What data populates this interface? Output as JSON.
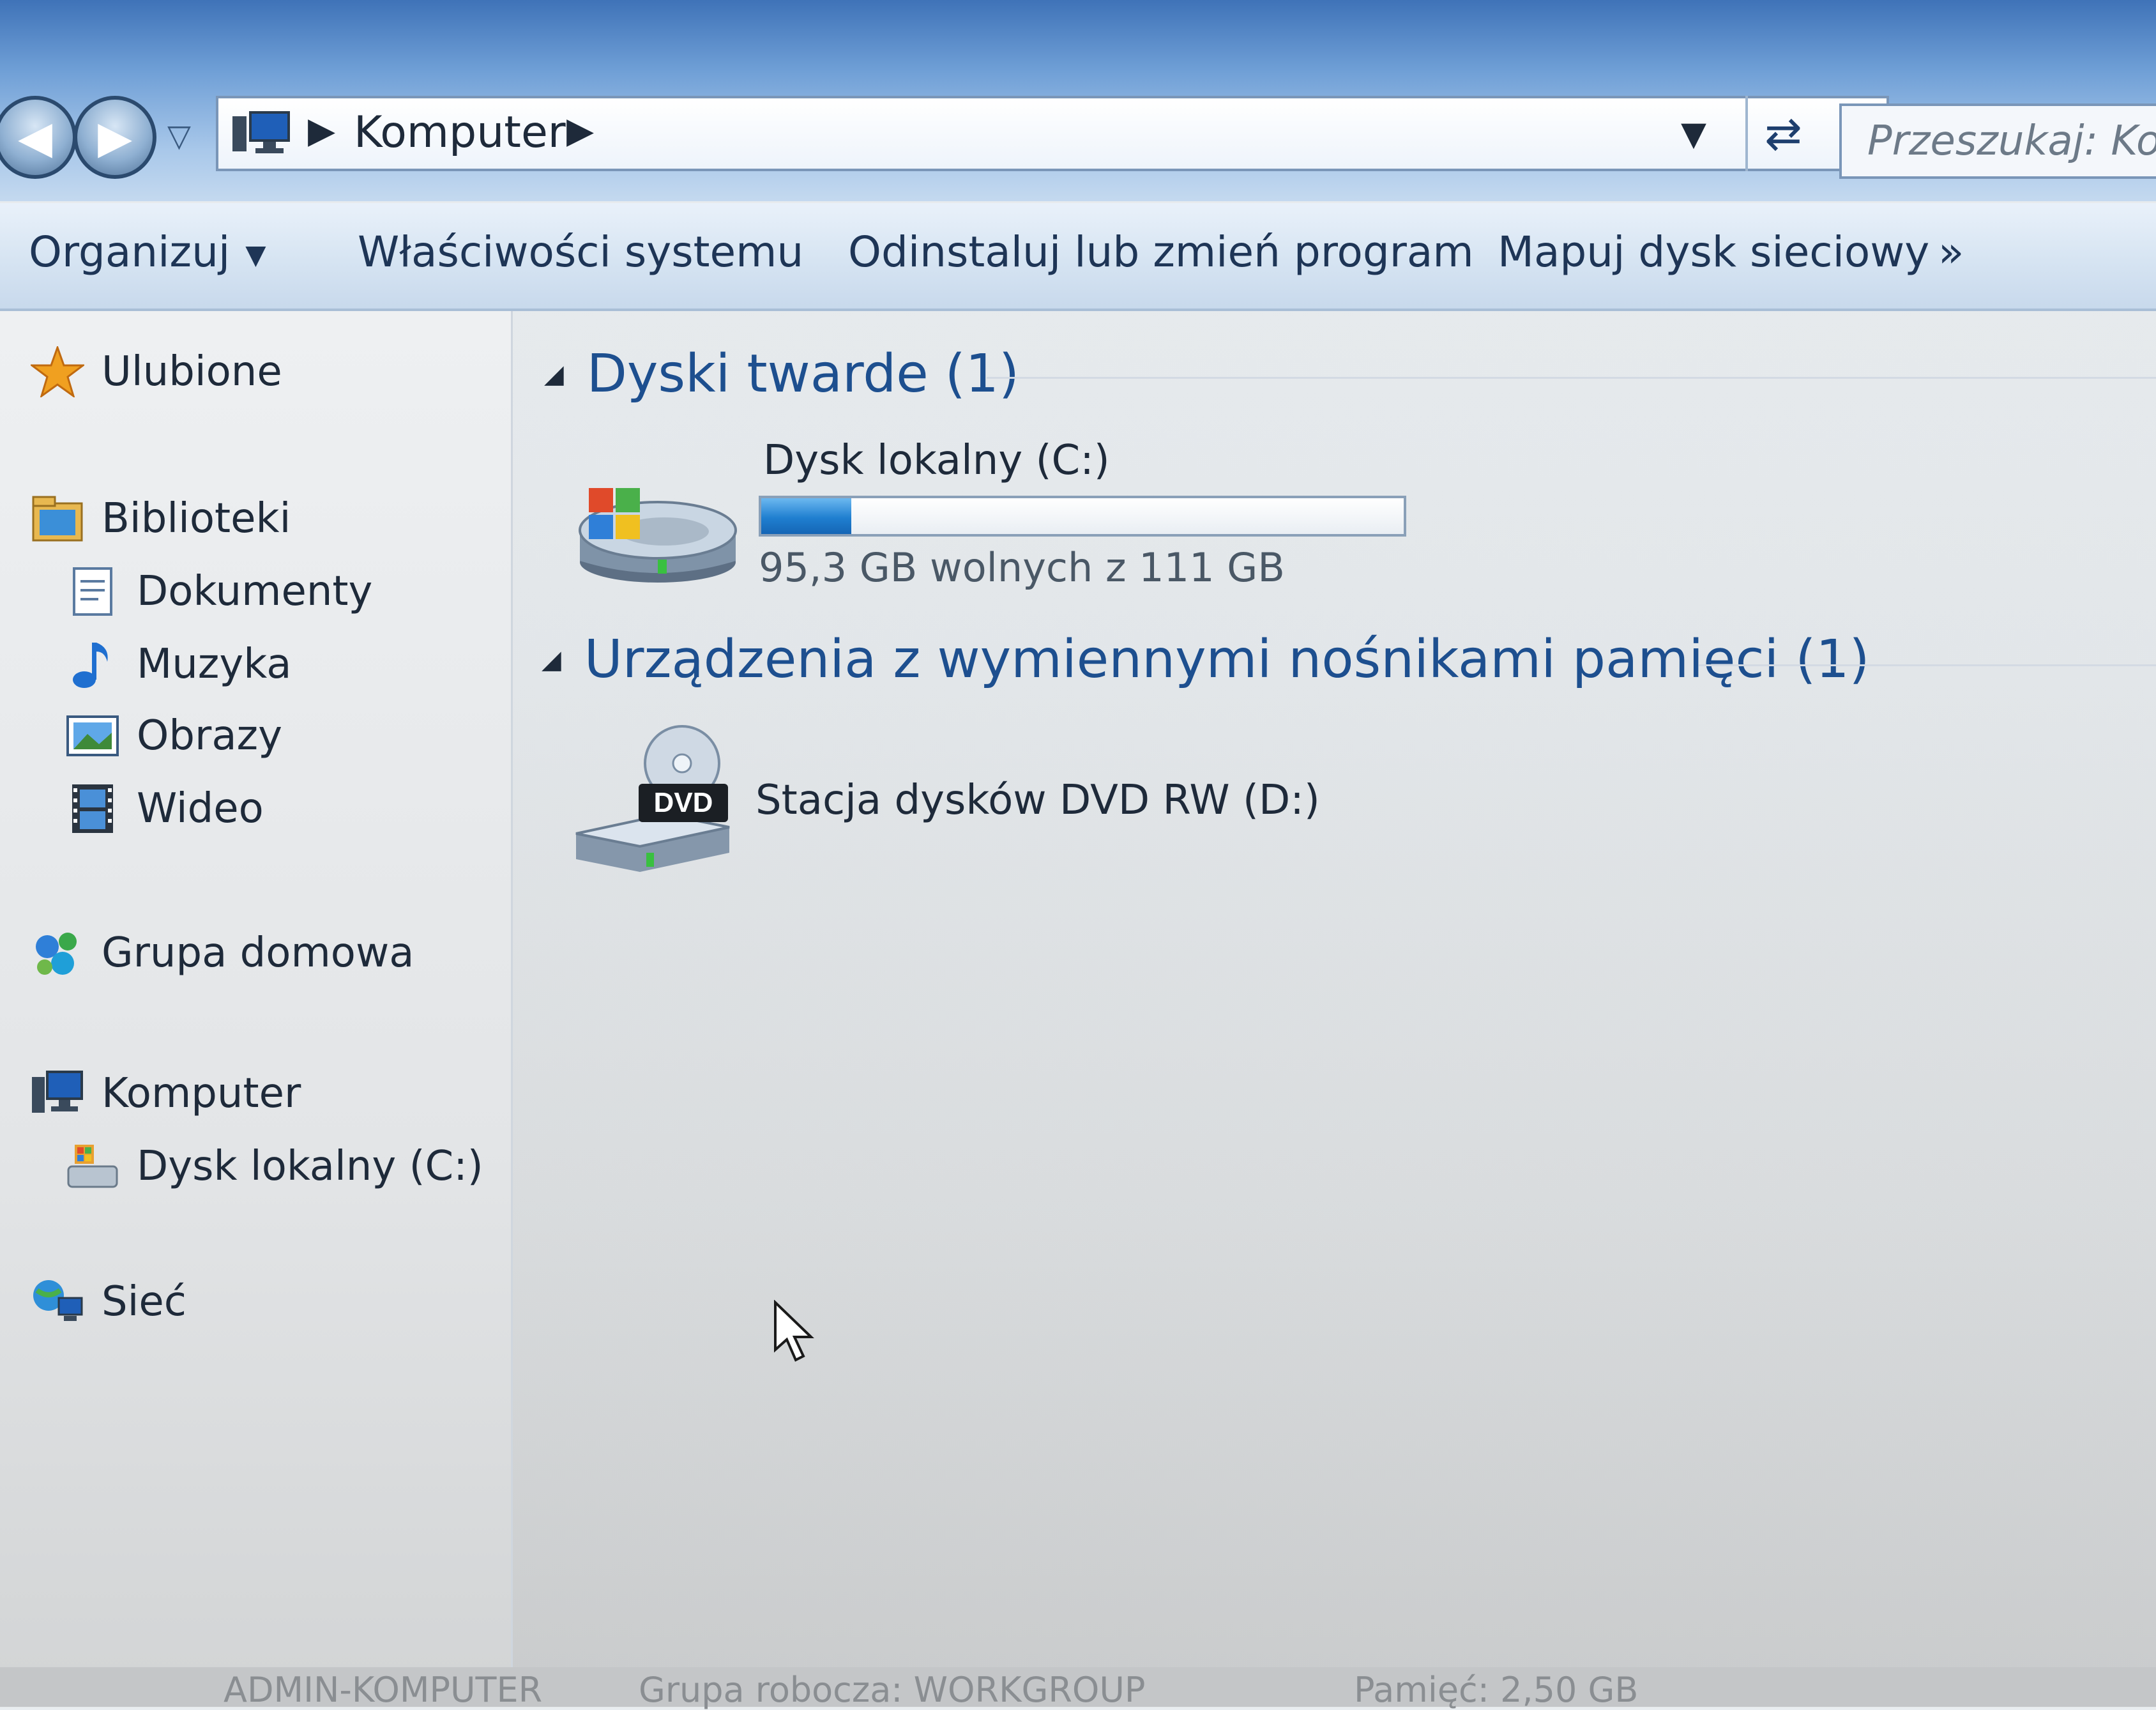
{
  "address": {
    "path_label": "Komputer",
    "search_placeholder": "Przeszukaj: Kom"
  },
  "toolbar": {
    "organize": "Organizuj",
    "system_properties": "Właściwości systemu",
    "uninstall": "Odinstaluj lub zmień program",
    "map_drive": "Mapuj dysk sieciowy",
    "more": "»"
  },
  "sidebar": {
    "favorites": "Ulubione",
    "libraries": "Biblioteki",
    "library_items": [
      "Dokumenty",
      "Muzyka",
      "Obrazy",
      "Wideo"
    ],
    "homegroup": "Grupa domowa",
    "computer": "Komputer",
    "computer_items": [
      "Dysk lokalny (C:)"
    ],
    "network": "Sieć"
  },
  "groups": {
    "hard_drives": {
      "title": "Dyski twarde (1)",
      "drive_name": "Dysk lokalny (C:)",
      "free_text": "95,3 GB wolnych z 111 GB",
      "used_fraction": 0.14
    },
    "removable": {
      "title": "Urządzenia z wymiennymi nośnikami pamięci (1)",
      "drive_name": "Stacja dysków DVD RW (D:)",
      "dvd_badge": "DVD"
    }
  },
  "status": {
    "computer_name": "ADMIN-KOMPUTER",
    "workgroup": "Grupa robocza: WORKGROUP",
    "memory": "Pamięć: 2,50 GB"
  },
  "colors": {
    "group_title": "#1d4f8f",
    "usage_fill": "#1f7fd0"
  }
}
